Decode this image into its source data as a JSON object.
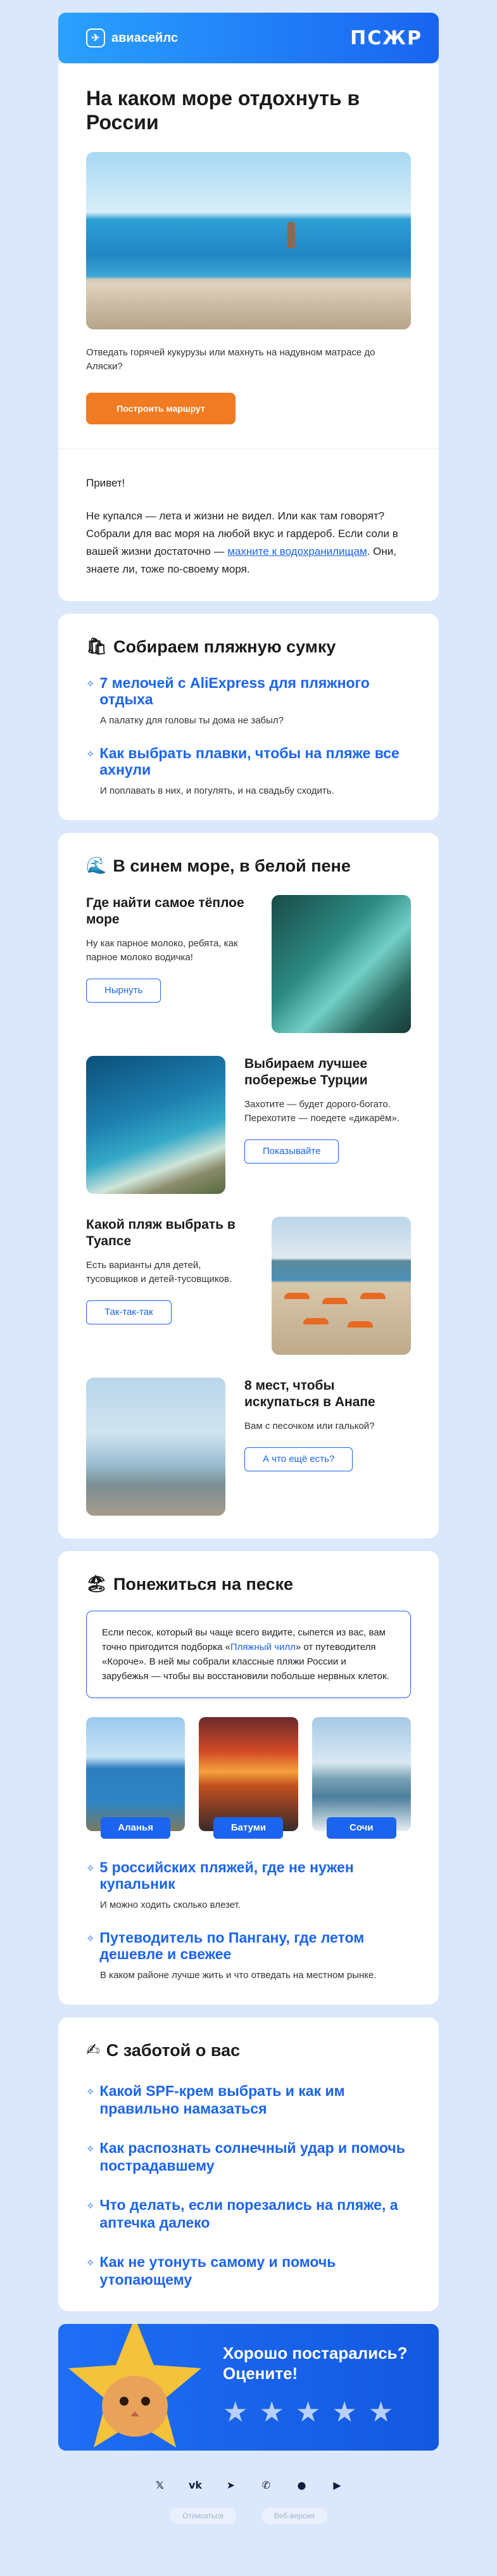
{
  "header": {
    "logo_text": "авиасейлс",
    "logo_icon": "plane-icon",
    "partner": "ПСЖР"
  },
  "hero": {
    "title": "На каком море отдохнуть в России",
    "text": "Отведать горячей кукурузы или махнуть на надувном матрасе до Аляски?",
    "button": "Построить маршрут"
  },
  "intro": {
    "greeting": "Привет!",
    "p1": "Не купался — лета и жизни не видел. Или как там говорят? Собрали для вас моря на любой вкус и гардероб. Если соли в вашей жизни достаточно —",
    "link": "махните к водохранилищам",
    "p1_end": ". Они, знаете ли, тоже по-своему моря."
  },
  "bag": {
    "title": "Собираем пляжную сумку",
    "emoji": "🛍",
    "items": [
      {
        "title": "7 мелочей с AliExpress для пляжного отдыха",
        "desc": "А палатку для головы ты дома не забыл?"
      },
      {
        "title": "Как выбрать плавки, чтобы на пляже все ахнули",
        "desc": "И поплавать в них, и погулять, и на свадьбу сходить."
      }
    ]
  },
  "sea": {
    "title": "В синем море, в белой пене",
    "emoji": "🌊",
    "articles": [
      {
        "title": "Где найти самое тёплое море",
        "desc": "Ну как парное молоко, ребята, как парное молоко водичка!",
        "button": "Нырнуть"
      },
      {
        "title": "Выбираем лучшее побережье Турции",
        "desc": "Захотите — будет дорого-богато. Перехотите — поедете «дикарём».",
        "button": "Показывайте"
      },
      {
        "title": "Какой пляж выбрать в Туапсе",
        "desc": "Есть варианты для детей, тусовщиков и детей-тусовщиков.",
        "button": "Так-так-так"
      },
      {
        "title": "8 мест, чтобы искупаться в Анапе",
        "desc": "Вам с песочком или галькой?",
        "button": "А что ещё есть?"
      }
    ]
  },
  "sand": {
    "title": "Понежиться на песке",
    "emoji": "🏖",
    "quote_start": "Если песок, который вы чаще всего видите, сыпется из вас, вам точно пригодится подборка «",
    "quote_link": "Пляжный чилл",
    "quote_end": "» от путеводителя «Короче». В ней мы собрали классные пляжи России и зарубежья — чтобы вы восстановили побольше нервных клеток.",
    "cities": [
      "Аланья",
      "Батуми",
      "Сочи"
    ],
    "items": [
      {
        "title": "5 российских пляжей, где не нужен купальник",
        "desc": "И можно ходить сколько влезет."
      },
      {
        "title": "Путеводитель по Пангану, где летом дешевле и свежее",
        "desc": "В каком районе лучше жить и что отведать на местном рынке."
      }
    ]
  },
  "care": {
    "title": "С заботой о вас",
    "emoji": "✍",
    "items": [
      "Какой SPF-крем выбрать и как им правильно намазаться",
      "Как распознать солнечный удар и помочь пострадавшему",
      "Что делать, если порезались на пляже, а аптечка далеко",
      "Как не утонуть самому и помочь утопающему"
    ]
  },
  "rate": {
    "question": "Хорошо постарались? Оцените!",
    "stars": 5
  },
  "socials": [
    "x-icon",
    "vk-icon",
    "telegram-icon",
    "viber-icon",
    "apple-icon",
    "google-play-icon"
  ],
  "footer": {
    "unsubscribe": "Отписаться",
    "web": "Веб-версия"
  }
}
